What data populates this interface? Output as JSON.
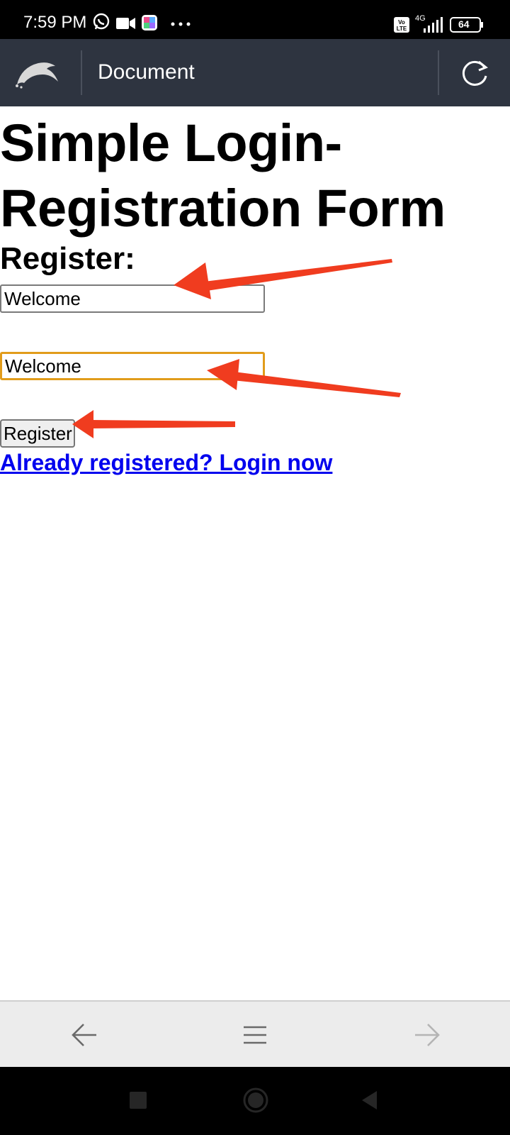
{
  "status_bar": {
    "time": "7:59 PM",
    "network": "4G",
    "battery": "64",
    "icons": [
      "whatsapp-icon",
      "video-camera-icon",
      "app-icon",
      "more-dots-icon",
      "volte-icon",
      "signal-icon",
      "battery-icon"
    ]
  },
  "toolbar": {
    "title": "Document",
    "logo_icon": "dolphin-logo-icon",
    "refresh_icon": "refresh-icon"
  },
  "page": {
    "title": "Simple Login-Registration Form",
    "section_heading": "Register:",
    "input_1_value": "Welcome",
    "input_2_value": "Welcome",
    "register_button_label": "Register",
    "login_link_text": "Already registered? Login now"
  },
  "browser_nav": {
    "back_icon": "back-arrow-icon",
    "menu_icon": "menu-icon",
    "forward_icon": "forward-arrow-icon"
  },
  "android_nav": {
    "icons": [
      "recents-square-icon",
      "home-circle-icon",
      "back-triangle-icon"
    ]
  },
  "colors": {
    "toolbar_bg": "#2e3440",
    "link": "#0000ee",
    "focus_border": "#e19c1b",
    "annotation_arrow": "#f03c1f"
  }
}
